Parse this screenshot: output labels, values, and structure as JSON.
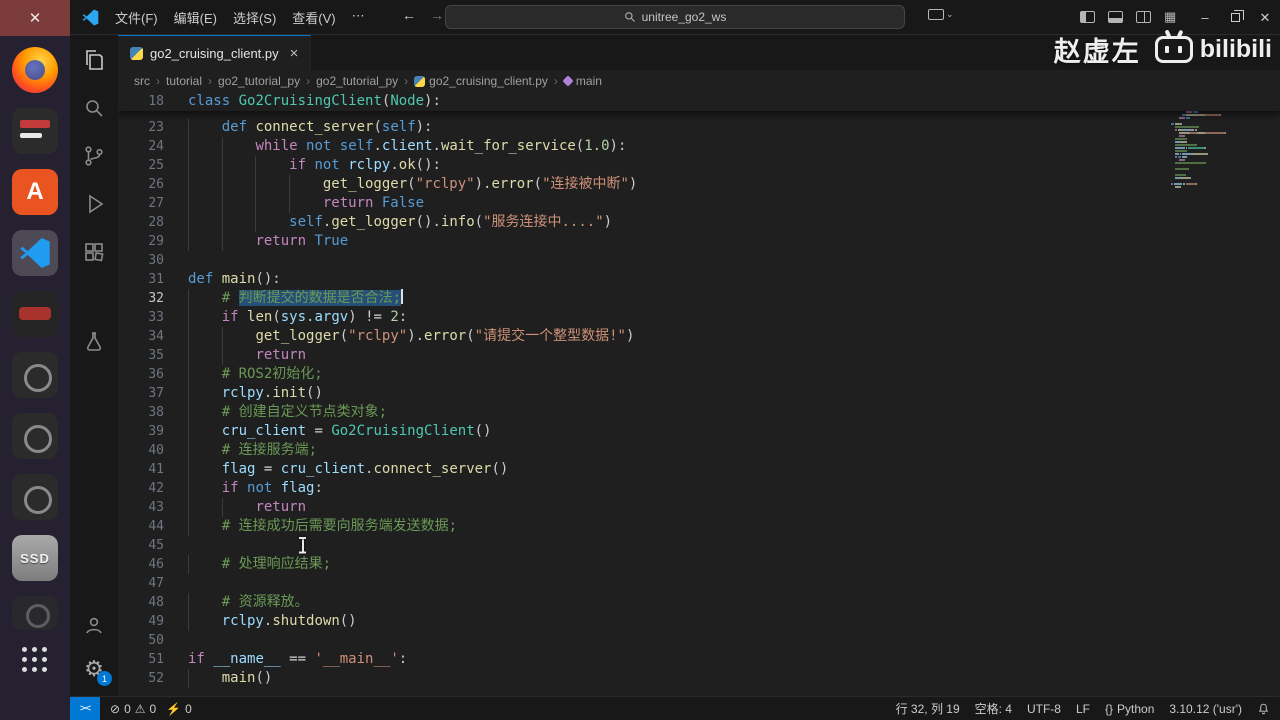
{
  "titlebar": {
    "menus": [
      "文件(F)",
      "编辑(E)",
      "选择(S)",
      "查看(V)",
      "⋯"
    ],
    "search_value": "unitree_go2_ws"
  },
  "tab": {
    "title": "go2_cruising_client.py"
  },
  "breadcrumbs": [
    "src",
    "tutorial",
    "go2_tutorial_py",
    "go2_tutorial_py",
    "go2_cruising_client.py",
    "main"
  ],
  "activitybar": {
    "settings_badge": "1"
  },
  "dock": {
    "ssd_label": "SSD"
  },
  "watermark": {
    "author": "赵虚左",
    "brand": "bilibili"
  },
  "statusbar": {
    "remote": "><",
    "errors": "0",
    "warnings": "0",
    "ports": "0",
    "cursor": "行 32, 列 19",
    "indent": "空格: 4",
    "encoding": "UTF-8",
    "eol": "LF",
    "lang_icon": "{}",
    "language": "Python",
    "interpreter": "3.10.12 ('usr')"
  },
  "editor": {
    "token_colors": {
      "kw": "#569cd6",
      "ctrl": "#c586c0",
      "cls": "#4ec9b0",
      "fn": "#dcdcaa",
      "str": "#ce9178",
      "com": "#6a9955",
      "num": "#b5cea8",
      "var": "#9cdcfe",
      "op": "#d4d4d4",
      "txt": "#cccccc",
      "self": "#569cd6",
      "sel": "#6a9955"
    },
    "lines": [
      {
        "n": 18,
        "sticky": true,
        "t": [
          [
            "kw",
            "class"
          ],
          [
            "txt",
            " "
          ],
          [
            "cls",
            "Go2CruisingClient"
          ],
          [
            "txt",
            "("
          ],
          [
            "cls",
            "Node"
          ],
          [
            "txt",
            "):"
          ]
        ]
      },
      {
        "n": 23,
        "t": [
          [
            "txt",
            "    "
          ],
          [
            "kw",
            "def"
          ],
          [
            "txt",
            " "
          ],
          [
            "fn",
            "connect_server"
          ],
          [
            "txt",
            "("
          ],
          [
            "self",
            "self"
          ],
          [
            "txt",
            "):"
          ]
        ]
      },
      {
        "n": 24,
        "t": [
          [
            "txt",
            "        "
          ],
          [
            "ctrl",
            "while"
          ],
          [
            "txt",
            " "
          ],
          [
            "kw",
            "not"
          ],
          [
            "txt",
            " "
          ],
          [
            "self",
            "self"
          ],
          [
            "txt",
            "."
          ],
          [
            "var",
            "client"
          ],
          [
            "txt",
            "."
          ],
          [
            "fn",
            "wait_for_service"
          ],
          [
            "txt",
            "("
          ],
          [
            "num",
            "1.0"
          ],
          [
            "txt",
            "):"
          ]
        ]
      },
      {
        "n": 25,
        "t": [
          [
            "txt",
            "            "
          ],
          [
            "ctrl",
            "if"
          ],
          [
            "txt",
            " "
          ],
          [
            "kw",
            "not"
          ],
          [
            "txt",
            " "
          ],
          [
            "var",
            "rclpy"
          ],
          [
            "txt",
            "."
          ],
          [
            "fn",
            "ok"
          ],
          [
            "txt",
            "():"
          ]
        ]
      },
      {
        "n": 26,
        "t": [
          [
            "txt",
            "                "
          ],
          [
            "fn",
            "get_logger"
          ],
          [
            "txt",
            "("
          ],
          [
            "str",
            "\"rclpy\""
          ],
          [
            "txt",
            ")."
          ],
          [
            "fn",
            "error"
          ],
          [
            "txt",
            "("
          ],
          [
            "str",
            "\"连接被中断\""
          ],
          [
            "txt",
            ")"
          ]
        ]
      },
      {
        "n": 27,
        "t": [
          [
            "txt",
            "                "
          ],
          [
            "ctrl",
            "return"
          ],
          [
            "txt",
            " "
          ],
          [
            "kw",
            "False"
          ]
        ]
      },
      {
        "n": 28,
        "t": [
          [
            "txt",
            "            "
          ],
          [
            "self",
            "self"
          ],
          [
            "txt",
            "."
          ],
          [
            "fn",
            "get_logger"
          ],
          [
            "txt",
            "()."
          ],
          [
            "fn",
            "info"
          ],
          [
            "txt",
            "("
          ],
          [
            "str",
            "\"服务连接中....\""
          ],
          [
            "txt",
            ")"
          ]
        ]
      },
      {
        "n": 29,
        "t": [
          [
            "txt",
            "        "
          ],
          [
            "ctrl",
            "return"
          ],
          [
            "txt",
            " "
          ],
          [
            "kw",
            "True"
          ]
        ]
      },
      {
        "n": 30,
        "t": []
      },
      {
        "n": 31,
        "t": [
          [
            "kw",
            "def"
          ],
          [
            "txt",
            " "
          ],
          [
            "fn",
            "main"
          ],
          [
            "txt",
            "():"
          ]
        ]
      },
      {
        "n": 32,
        "current": true,
        "t": [
          [
            "txt",
            "    "
          ],
          [
            "com",
            "# "
          ],
          [
            "sel",
            "判断提交的数据是否合法;"
          ],
          [
            "caret",
            ""
          ]
        ]
      },
      {
        "n": 33,
        "t": [
          [
            "txt",
            "    "
          ],
          [
            "ctrl",
            "if"
          ],
          [
            "txt",
            " "
          ],
          [
            "fn",
            "len"
          ],
          [
            "txt",
            "("
          ],
          [
            "var",
            "sys"
          ],
          [
            "txt",
            "."
          ],
          [
            "var",
            "argv"
          ],
          [
            "txt",
            ") "
          ],
          [
            "op",
            "!="
          ],
          [
            "txt",
            " "
          ],
          [
            "num",
            "2"
          ],
          [
            "txt",
            ":"
          ]
        ]
      },
      {
        "n": 34,
        "t": [
          [
            "txt",
            "        "
          ],
          [
            "fn",
            "get_logger"
          ],
          [
            "txt",
            "("
          ],
          [
            "str",
            "\"rclpy\""
          ],
          [
            "txt",
            ")."
          ],
          [
            "fn",
            "error"
          ],
          [
            "txt",
            "("
          ],
          [
            "str",
            "\"请提交一个整型数据!\""
          ],
          [
            "txt",
            ")"
          ]
        ]
      },
      {
        "n": 35,
        "t": [
          [
            "txt",
            "        "
          ],
          [
            "ctrl",
            "return"
          ]
        ]
      },
      {
        "n": 36,
        "t": [
          [
            "txt",
            "    "
          ],
          [
            "com",
            "# ROS2初始化;"
          ]
        ]
      },
      {
        "n": 37,
        "t": [
          [
            "txt",
            "    "
          ],
          [
            "var",
            "rclpy"
          ],
          [
            "txt",
            "."
          ],
          [
            "fn",
            "init"
          ],
          [
            "txt",
            "()"
          ]
        ]
      },
      {
        "n": 38,
        "t": [
          [
            "txt",
            "    "
          ],
          [
            "com",
            "# 创建自定义节点类对象;"
          ]
        ]
      },
      {
        "n": 39,
        "t": [
          [
            "txt",
            "    "
          ],
          [
            "var",
            "cru_client"
          ],
          [
            "txt",
            " "
          ],
          [
            "op",
            "="
          ],
          [
            "txt",
            " "
          ],
          [
            "cls",
            "Go2CruisingClient"
          ],
          [
            "txt",
            "()"
          ]
        ]
      },
      {
        "n": 40,
        "t": [
          [
            "txt",
            "    "
          ],
          [
            "com",
            "# 连接服务端;"
          ]
        ]
      },
      {
        "n": 41,
        "t": [
          [
            "txt",
            "    "
          ],
          [
            "var",
            "flag"
          ],
          [
            "txt",
            " "
          ],
          [
            "op",
            "="
          ],
          [
            "txt",
            " "
          ],
          [
            "var",
            "cru_client"
          ],
          [
            "txt",
            "."
          ],
          [
            "fn",
            "connect_server"
          ],
          [
            "txt",
            "()"
          ]
        ]
      },
      {
        "n": 42,
        "t": [
          [
            "txt",
            "    "
          ],
          [
            "ctrl",
            "if"
          ],
          [
            "txt",
            " "
          ],
          [
            "kw",
            "not"
          ],
          [
            "txt",
            " "
          ],
          [
            "var",
            "flag"
          ],
          [
            "txt",
            ":"
          ]
        ]
      },
      {
        "n": 43,
        "t": [
          [
            "txt",
            "        "
          ],
          [
            "ctrl",
            "return"
          ]
        ]
      },
      {
        "n": 44,
        "t": [
          [
            "txt",
            "    "
          ],
          [
            "com",
            "# 连接成功后需要向服务端发送数据;"
          ]
        ]
      },
      {
        "n": 45,
        "t": []
      },
      {
        "n": 46,
        "t": [
          [
            "txt",
            "    "
          ],
          [
            "com",
            "# 处理响应结果;"
          ]
        ]
      },
      {
        "n": 47,
        "t": []
      },
      {
        "n": 48,
        "t": [
          [
            "txt",
            "    "
          ],
          [
            "com",
            "# 资源释放。"
          ]
        ]
      },
      {
        "n": 49,
        "t": [
          [
            "txt",
            "    "
          ],
          [
            "var",
            "rclpy"
          ],
          [
            "txt",
            "."
          ],
          [
            "fn",
            "shutdown"
          ],
          [
            "txt",
            "()"
          ]
        ]
      },
      {
        "n": 50,
        "t": []
      },
      {
        "n": 51,
        "t": [
          [
            "ctrl",
            "if"
          ],
          [
            "txt",
            " "
          ],
          [
            "var",
            "__name__"
          ],
          [
            "txt",
            " "
          ],
          [
            "op",
            "=="
          ],
          [
            "txt",
            " "
          ],
          [
            "str",
            "'__main__'"
          ],
          [
            "txt",
            ":"
          ]
        ]
      },
      {
        "n": 52,
        "t": [
          [
            "txt",
            "    "
          ],
          [
            "fn",
            "main"
          ],
          [
            "txt",
            "()"
          ]
        ]
      }
    ]
  }
}
